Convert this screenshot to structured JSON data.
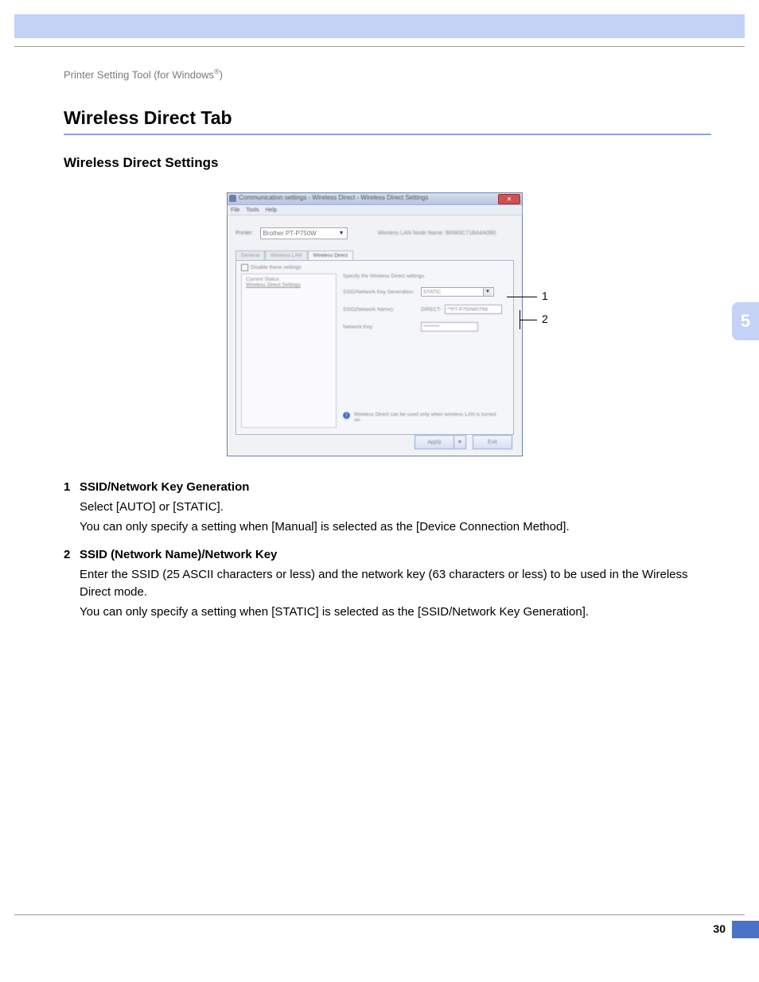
{
  "header": {
    "breadcrumb_pre": "Printer Setting Tool (for Windows",
    "breadcrumb_sup": "®",
    "breadcrumb_post": ")"
  },
  "title": "Wireless Direct Tab",
  "subheading": "Wireless Direct Settings",
  "chapter": "5",
  "page_number": "30",
  "win": {
    "title": "Communication settings - Wireless Direct - Wireless Direct Settings",
    "menu": {
      "file": "File",
      "tools": "Tools",
      "help": "Help"
    },
    "printer_label": "Printer:",
    "printer_value": "Brother PT-P750W",
    "node_name": "Wireless LAN Node Name: BRW0C71BA4A0B0",
    "tabs": {
      "general": "General",
      "wlan": "Wireless LAN",
      "wd": "Wireless Direct"
    },
    "disable": "Disable these settings",
    "tree": {
      "l1": "Current Status",
      "l2": "Wireless Direct Settings"
    },
    "section": "Specify the Wireless Direct settings.",
    "row1_label": "SSID/Network Key Generation:",
    "row1_value": "STATIC",
    "row2_label": "SSID(Network Name):",
    "row2_prefix": "DIRECT-",
    "row2_value": "**PT-P750W0798",
    "row3_label": "Network Key:",
    "row3_value": "********",
    "note": "Wireless Direct can be used only when wireless LAN is turned on.",
    "apply": "Apply",
    "exit": "Exit"
  },
  "callouts": {
    "c1": "1",
    "c2": "2"
  },
  "items": [
    {
      "num": "1",
      "title": "SSID/Network Key Generation",
      "lines": [
        "Select [AUTO] or [STATIC].",
        "You can only specify a setting when  [Manual] is selected as the [Device Connection Method]."
      ]
    },
    {
      "num": "2",
      "title": "SSID (Network Name)/Network Key",
      "lines": [
        "Enter the SSID (25 ASCII characters or less) and the network key (63 characters or less) to be used in the Wireless Direct mode.",
        "You can only specify a setting when  [STATIC] is selected as the [SSID/Network Key Generation]."
      ]
    }
  ]
}
